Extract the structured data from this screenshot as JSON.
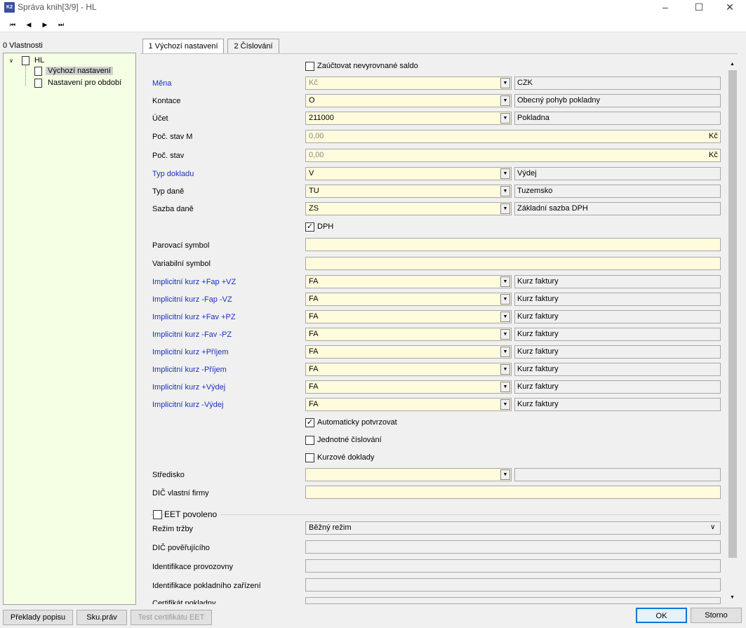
{
  "window": {
    "title": "Správa knih[3/9] - HL",
    "app_icon_text": "K2"
  },
  "nav": {
    "first": "⏮",
    "prev": "◀",
    "next": "▶",
    "last": "⏭"
  },
  "tree": {
    "header": "0 Vlastnosti",
    "root": "HL",
    "children": [
      "Výchozí nastavení",
      "Nastavení pro období"
    ]
  },
  "tabs": [
    "1 Výchozí nastavení",
    "2 Číslování"
  ],
  "form": {
    "zauctovat": "Zaúčtovat nevyrovnané saldo",
    "mena": {
      "label": "Měna",
      "value": "Kč",
      "desc": "CZK"
    },
    "kontace": {
      "label": "Kontace",
      "value": "O",
      "desc": "Obecný pohyb pokladny"
    },
    "ucet": {
      "label": "Účet",
      "value": "211000",
      "desc": "Pokladna"
    },
    "poc_stav_m": {
      "label": "Poč. stav M",
      "value": "0,00",
      "unit": "Kč"
    },
    "poc_stav": {
      "label": "Poč. stav",
      "value": "0,00",
      "unit": "Kč"
    },
    "typ_dokladu": {
      "label": "Typ dokladu",
      "value": "V",
      "desc": "Výdej"
    },
    "typ_dane": {
      "label": "Typ daně",
      "value": "TU",
      "desc": "Tuzemsko"
    },
    "sazba_dane": {
      "label": "Sazba daně",
      "value": "ZS",
      "desc": "Základní sazba DPH"
    },
    "dph": "DPH",
    "parovaci": {
      "label": "Parovací symbol",
      "value": ""
    },
    "variabilni": {
      "label": "Variabilní symbol",
      "value": ""
    },
    "kurzy": [
      {
        "label": "Implicitní kurz +Fap +VZ",
        "value": "FA",
        "desc": "Kurz faktury"
      },
      {
        "label": "Implicitní kurz -Fap -VZ",
        "value": "FA",
        "desc": "Kurz faktury"
      },
      {
        "label": "Implicitní kurz +Fav +PZ",
        "value": "FA",
        "desc": "Kurz faktury"
      },
      {
        "label": "Implicitní kurz -Fav -PZ",
        "value": "FA",
        "desc": "Kurz faktury"
      },
      {
        "label": "Implicitní kurz +Příjem",
        "value": "FA",
        "desc": "Kurz faktury"
      },
      {
        "label": "Implicitní kurz -Příjem",
        "value": "FA",
        "desc": "Kurz faktury"
      },
      {
        "label": "Implicitní kurz +Výdej",
        "value": "FA",
        "desc": "Kurz faktury"
      },
      {
        "label": "Implicitní kurz -Výdej",
        "value": "FA",
        "desc": "Kurz faktury"
      }
    ],
    "auto_potvrzovat": "Automaticky potvrzovat",
    "jednotne": "Jednotné číslování",
    "kurzove": "Kurzové doklady",
    "stredisko": {
      "label": "Středisko",
      "value": ""
    },
    "dic_firmy": {
      "label": "DIČ vlastní firmy",
      "value": ""
    },
    "eet": {
      "title": "EET povoleno",
      "rezim": {
        "label": "Režim tržby",
        "value": "Běžný režim"
      },
      "dic_poverujiciho": "DIČ pověřujícího",
      "provozovna": "Identifikace provozovny",
      "zarizeni": "Identifikace pokladního zařízení",
      "certifikat": "Certifikát pokladny"
    }
  },
  "buttons": {
    "preklady": "Překlady popisu",
    "sku": "Sku.práv",
    "test_eet": "Test certifikátu EET",
    "ok": "OK",
    "storno": "Storno"
  },
  "checks": {
    "zauctovat": false,
    "dph": true,
    "auto": true,
    "jednotne": false,
    "kurzove": false,
    "eet": false
  }
}
